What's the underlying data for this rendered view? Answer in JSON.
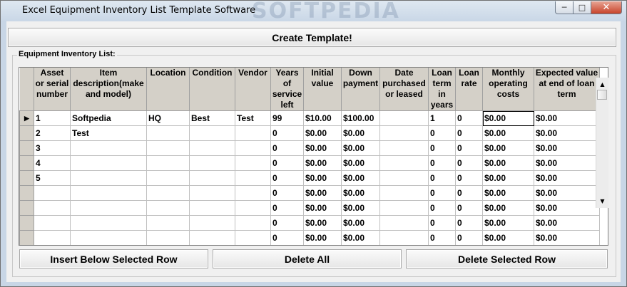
{
  "window": {
    "title": "Excel Equipment Inventory List Template Software",
    "watermark": "SOFTPEDIA"
  },
  "toolbar": {
    "create_label": "Create Template!"
  },
  "group": {
    "label": "Equipment Inventory List:"
  },
  "table": {
    "columns": [
      "Asset or serial number",
      "Item description(make and model)",
      "Location",
      "Condition",
      "Vendor",
      "Years of service left",
      "Initial value",
      "Down payment",
      "Date purchased or leased",
      "Loan term in years",
      "Loan rate",
      "Monthly operating costs",
      "Expected value at end of loan term"
    ],
    "rows": [
      [
        "1",
        "Softpedia",
        "HQ",
        "Best",
        "Test",
        "99",
        "$10.00",
        "$100.00",
        "",
        "1",
        "0",
        "$0.00",
        "$0.00"
      ],
      [
        "2",
        "Test",
        "",
        "",
        "",
        "0",
        "$0.00",
        "$0.00",
        "",
        "0",
        "0",
        "$0.00",
        "$0.00"
      ],
      [
        "3",
        "",
        "",
        "",
        "",
        "0",
        "$0.00",
        "$0.00",
        "",
        "0",
        "0",
        "$0.00",
        "$0.00"
      ],
      [
        "4",
        "",
        "",
        "",
        "",
        "0",
        "$0.00",
        "$0.00",
        "",
        "0",
        "0",
        "$0.00",
        "$0.00"
      ],
      [
        "5",
        "",
        "",
        "",
        "",
        "0",
        "$0.00",
        "$0.00",
        "",
        "0",
        "0",
        "$0.00",
        "$0.00"
      ],
      [
        "",
        "",
        "",
        "",
        "",
        "0",
        "$0.00",
        "$0.00",
        "",
        "0",
        "0",
        "$0.00",
        "$0.00"
      ],
      [
        "",
        "",
        "",
        "",
        "",
        "0",
        "$0.00",
        "$0.00",
        "",
        "0",
        "0",
        "$0.00",
        "$0.00"
      ],
      [
        "",
        "",
        "",
        "",
        "",
        "0",
        "$0.00",
        "$0.00",
        "",
        "0",
        "0",
        "$0.00",
        "$0.00"
      ],
      [
        "",
        "",
        "",
        "",
        "",
        "0",
        "$0.00",
        "$0.00",
        "",
        "0",
        "0",
        "$0.00",
        "$0.00"
      ]
    ]
  },
  "actions": {
    "insert_label": "Insert Below Selected Row",
    "delete_all_label": "Delete All",
    "delete_selected_label": "Delete Selected Row"
  }
}
